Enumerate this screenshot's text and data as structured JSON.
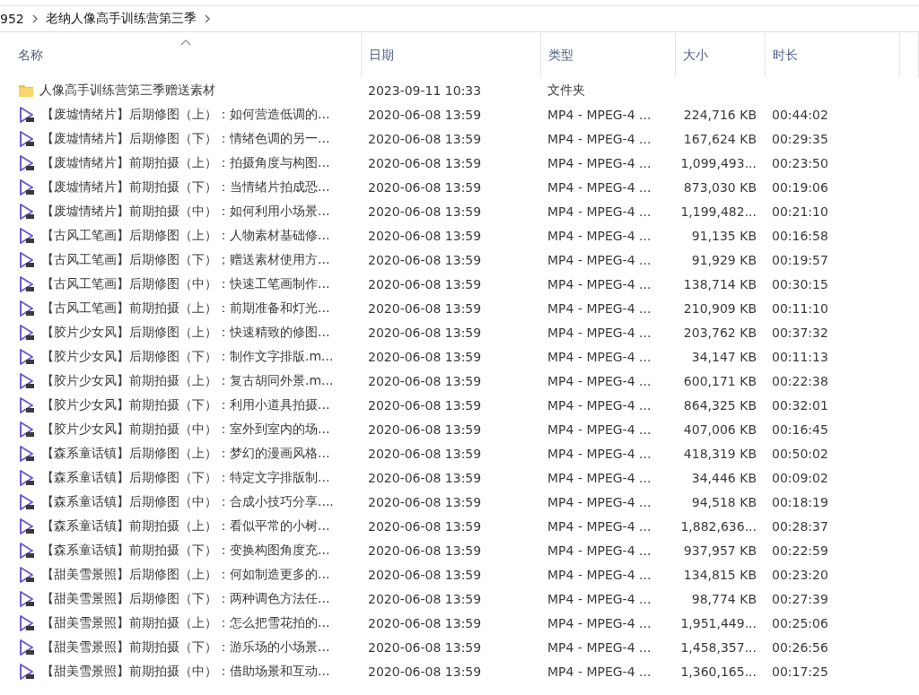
{
  "breadcrumb": {
    "items": [
      {
        "label": "952"
      },
      {
        "label": "老纳人像高手训练营第三季"
      }
    ]
  },
  "table": {
    "columns": [
      {
        "label": "名称",
        "sorted": true
      },
      {
        "label": "日期",
        "sorted": false
      },
      {
        "label": "类型",
        "sorted": false
      },
      {
        "label": "大小",
        "sorted": false
      },
      {
        "label": "时长",
        "sorted": false
      }
    ],
    "rows": [
      {
        "kind": "folder",
        "name": "人像高手训练营第三季赠送素材",
        "date": "2023-09-11 10:33",
        "type": "文件夹"
      },
      {
        "kind": "video",
        "name": "【废墟情绪片】后期修图（上）：如何营造低调的...",
        "date": "2020-06-08 13:59",
        "type": "MP4 - MPEG-4 ...",
        "size": "224,716 KB",
        "duration": "00:44:02"
      },
      {
        "kind": "video",
        "name": "【废墟情绪片】后期修图（下）：情绪色调的另一...",
        "date": "2020-06-08 13:59",
        "type": "MP4 - MPEG-4 ...",
        "size": "167,624 KB",
        "duration": "00:29:35"
      },
      {
        "kind": "video",
        "name": "【废墟情绪片】前期拍摄（上）：拍摄角度与构图...",
        "date": "2020-06-08 13:59",
        "type": "MP4 - MPEG-4 ...",
        "size": "1,099,493...",
        "duration": "00:23:50"
      },
      {
        "kind": "video",
        "name": "【废墟情绪片】前期拍摄（下）：当情绪片拍成恐...",
        "date": "2020-06-08 13:59",
        "type": "MP4 - MPEG-4 ...",
        "size": "873,030 KB",
        "duration": "00:19:06"
      },
      {
        "kind": "video",
        "name": "【废墟情绪片】前期拍摄（中）：如何利用小场景...",
        "date": "2020-06-08 13:59",
        "type": "MP4 - MPEG-4 ...",
        "size": "1,199,482...",
        "duration": "00:21:10"
      },
      {
        "kind": "video",
        "name": "【古风工笔画】后期修图（上）：人物素材基础修...",
        "date": "2020-06-08 13:59",
        "type": "MP4 - MPEG-4 ...",
        "size": "91,135 KB",
        "duration": "00:16:58"
      },
      {
        "kind": "video",
        "name": "【古风工笔画】后期修图（下）；赠送素材使用方...",
        "date": "2020-06-08 13:59",
        "type": "MP4 - MPEG-4 ...",
        "size": "91,929 KB",
        "duration": "00:19:57"
      },
      {
        "kind": "video",
        "name": "【古风工笔画】后期修图（中）：快速工笔画制作...",
        "date": "2020-06-08 13:59",
        "type": "MP4 - MPEG-4 ...",
        "size": "138,714 KB",
        "duration": "00:30:15"
      },
      {
        "kind": "video",
        "name": "【古风工笔画】前期拍摄（上）：前期准备和灯光...",
        "date": "2020-06-08 13:59",
        "type": "MP4 - MPEG-4 ...",
        "size": "210,909 KB",
        "duration": "00:11:10"
      },
      {
        "kind": "video",
        "name": "【胶片少女风】后期修图（上）：快速精致的修图...",
        "date": "2020-06-08 13:59",
        "type": "MP4 - MPEG-4 ...",
        "size": "203,762 KB",
        "duration": "00:37:32"
      },
      {
        "kind": "video",
        "name": "【胶片少女风】后期修图（下）：制作文字排版.m...",
        "date": "2020-06-08 13:59",
        "type": "MP4 - MPEG-4 ...",
        "size": "34,147 KB",
        "duration": "00:11:13"
      },
      {
        "kind": "video",
        "name": "【胶片少女风】前期拍摄（上）：复古胡同外景.m...",
        "date": "2020-06-08 13:59",
        "type": "MP4 - MPEG-4 ...",
        "size": "600,171 KB",
        "duration": "00:22:38"
      },
      {
        "kind": "video",
        "name": "【胶片少女风】前期拍摄（下）：利用小道具拍摄...",
        "date": "2020-06-08 13:59",
        "type": "MP4 - MPEG-4 ...",
        "size": "864,325 KB",
        "duration": "00:32:01"
      },
      {
        "kind": "video",
        "name": "【胶片少女风】前期拍摄（中）：室外到室内的场...",
        "date": "2020-06-08 13:59",
        "type": "MP4 - MPEG-4 ...",
        "size": "407,006 KB",
        "duration": "00:16:45"
      },
      {
        "kind": "video",
        "name": "【森系童话镇】后期修图（上）：梦幻的漫画风格...",
        "date": "2020-06-08 13:59",
        "type": "MP4 - MPEG-4 ...",
        "size": "418,319 KB",
        "duration": "00:50:02"
      },
      {
        "kind": "video",
        "name": "【森系童话镇】后期修图（下）：特定文字排版制...",
        "date": "2020-06-08 13:59",
        "type": "MP4 - MPEG-4 ...",
        "size": "34,446 KB",
        "duration": "00:09:02"
      },
      {
        "kind": "video",
        "name": "【森系童话镇】后期修图（中）：合成小技巧分享....",
        "date": "2020-06-08 13:59",
        "type": "MP4 - MPEG-4 ...",
        "size": "94,518 KB",
        "duration": "00:18:19"
      },
      {
        "kind": "video",
        "name": "【森系童话镇】前期拍摄（上）：看似平常的小树...",
        "date": "2020-06-08 13:59",
        "type": "MP4 - MPEG-4 ...",
        "size": "1,882,636...",
        "duration": "00:28:37"
      },
      {
        "kind": "video",
        "name": "【森系童话镇】前期拍摄（下）：变换构图角度充...",
        "date": "2020-06-08 13:59",
        "type": "MP4 - MPEG-4 ...",
        "size": "937,957 KB",
        "duration": "00:22:59"
      },
      {
        "kind": "video",
        "name": "【甜美雪景照】后期修图（上）：何如制造更多的...",
        "date": "2020-06-08 13:59",
        "type": "MP4 - MPEG-4 ...",
        "size": "134,815 KB",
        "duration": "00:23:20"
      },
      {
        "kind": "video",
        "name": "【甜美雪景照】后期修图（下）：两种调色方法任...",
        "date": "2020-06-08 13:59",
        "type": "MP4 - MPEG-4 ...",
        "size": "98,774 KB",
        "duration": "00:27:39"
      },
      {
        "kind": "video",
        "name": "【甜美雪景照】前期拍摄（上）：怎么把雪花拍的...",
        "date": "2020-06-08 13:59",
        "type": "MP4 - MPEG-4 ...",
        "size": "1,951,449...",
        "duration": "00:25:06"
      },
      {
        "kind": "video",
        "name": "【甜美雪景照】前期拍摄（下）：游乐场的小场景...",
        "date": "2020-06-08 13:59",
        "type": "MP4 - MPEG-4 ...",
        "size": "1,458,357...",
        "duration": "00:26:56"
      },
      {
        "kind": "video",
        "name": "【甜美雪景照】前期拍摄（中）：借助场景和互动...",
        "date": "2020-06-08 13:59",
        "type": "MP4 - MPEG-4 ...",
        "size": "1,360,165...",
        "duration": "00:17:25"
      }
    ]
  }
}
